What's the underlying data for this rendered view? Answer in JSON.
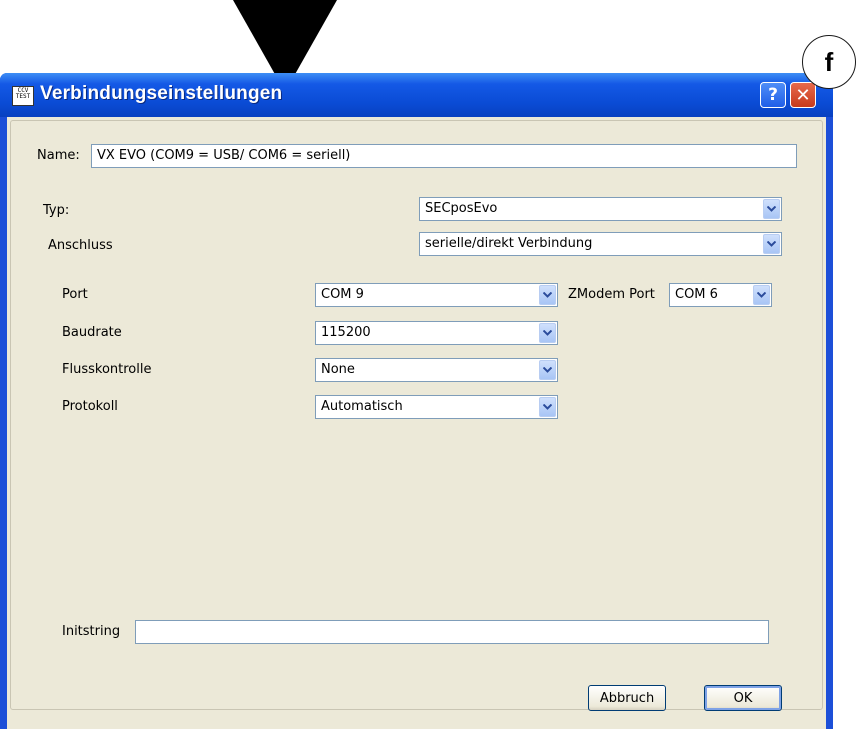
{
  "annotation": {
    "callout_letter": "f"
  },
  "window": {
    "title": "Verbindungseinstellungen",
    "app_icon_text": "CCV\nTEST",
    "help_label": "?",
    "close_label": "✕"
  },
  "form": {
    "name_label": "Name:",
    "name_value": "VX EVO (COM9 = USB/ COM6 = seriell)",
    "typ_label": "Typ:",
    "typ_value": "SECposEvo",
    "anschluss_label": "Anschluss",
    "anschluss_value": "serielle/direkt Verbindung",
    "port_label": "Port",
    "port_value": "COM 9",
    "zmodem_label": "ZModem Port",
    "zmodem_value": "COM 6",
    "baudrate_label": "Baudrate",
    "baudrate_value": "115200",
    "fluss_label": "Flusskontrolle",
    "fluss_value": "None",
    "protokoll_label": "Protokoll",
    "protokoll_value": "Automatisch",
    "initstring_label": "Initstring",
    "initstring_value": ""
  },
  "buttons": {
    "cancel_label": "Abbruch",
    "ok_label": "OK"
  },
  "colors": {
    "titlebar": "#0a4bd4",
    "client": "#ece9d8",
    "field_border": "#7f9db9"
  },
  "icons": [
    "app-icon",
    "help-icon",
    "close-icon",
    "chevron-down-icon"
  ]
}
